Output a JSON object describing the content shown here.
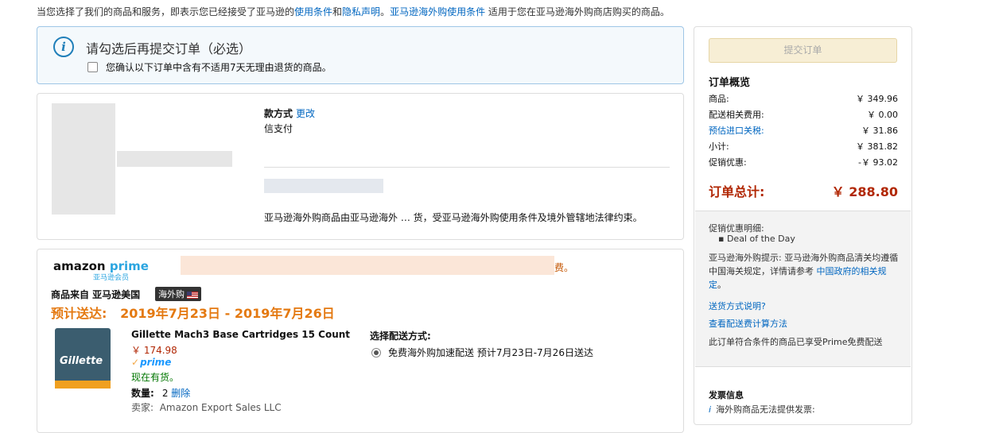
{
  "top_notice": {
    "prefix": "当您选择了我们的商品和服务，即表示您已经接受了亚马逊的",
    "terms_link": "使用条件",
    "and": "和",
    "privacy_link": "隐私声明",
    "sep": "。",
    "global_link": "亚马逊海外购使用条件",
    "suffix": " 适用于您在亚马逊海外购商店购买的商品。"
  },
  "confirm_notice": {
    "title": "请勾选后再提交订单（必选）",
    "checkbox_label": "您确认以下订单中含有不适用7天无理由退货的商品。"
  },
  "payment": {
    "heading": "款方式",
    "change_link": "更改",
    "method": "信支付"
  },
  "law_text": "亚马逊海外购商品由亚马逊海外 … 货，受亚马逊海外购使用条件及境外管辖地法律约束。",
  "shipment": {
    "prime_logo_a": "amazon",
    "prime_logo_b": "prime",
    "prime_sub": "亚马逊会员",
    "prime_note": "费。",
    "origin": "商品来自 亚马逊美国",
    "badge": "海外购",
    "eta_label": "预计送达:",
    "eta_range": "2019年7月23日 - 2019年7月26日",
    "item": {
      "image_text": "Gillette",
      "name": "Gillette Mach3 Base Cartridges 15 Count",
      "price": "￥ 174.98",
      "prime": "prime",
      "stock": "现在有货。",
      "qty_label": "数量:",
      "qty": "2",
      "delete": "删除",
      "seller_label": "卖家:",
      "seller": "Amazon Export Sales LLC"
    },
    "ship_heading": "选择配送方式:",
    "ship_option": "免费海外购加速配送 预计7月23日-7月26日送达"
  },
  "summary": {
    "place_order": "提交订单",
    "title": "订单概览",
    "rows": [
      {
        "label": "商品:",
        "value": "￥ 349.96"
      },
      {
        "label": "配送相关费用:",
        "value": "￥ 0.00"
      },
      {
        "label": "预估进口关税:",
        "value": "￥ 31.86"
      },
      {
        "label": "小计:",
        "value": "￥ 381.82"
      },
      {
        "label": "促销优惠:",
        "value": "-￥ 93.02"
      }
    ],
    "total_label": "订单总计:",
    "total_value": "￥ 288.80",
    "promo_title": "促销优惠明细:",
    "promo_item": "Deal of the Day",
    "tip_text": "亚马逊海外购提示: 亚马逊海外购商品清关均遵循中国海关规定，详情请参考",
    "tip_link1": "中国政府的相关规定",
    "tip_end": "。",
    "ship_explain": "送货方式说明?",
    "ship_fee": "查看配送费计算方法",
    "prime_eligible": "此订单符合条件的商品已享受Prime免费配送",
    "invoice_title": "发票信息",
    "invoice_text": "海外购商品无法提供发票:"
  },
  "colors": {
    "link": "#0066c0",
    "price": "#b12704",
    "eta": "#e47911",
    "notice_border": "#9fc6e6"
  }
}
